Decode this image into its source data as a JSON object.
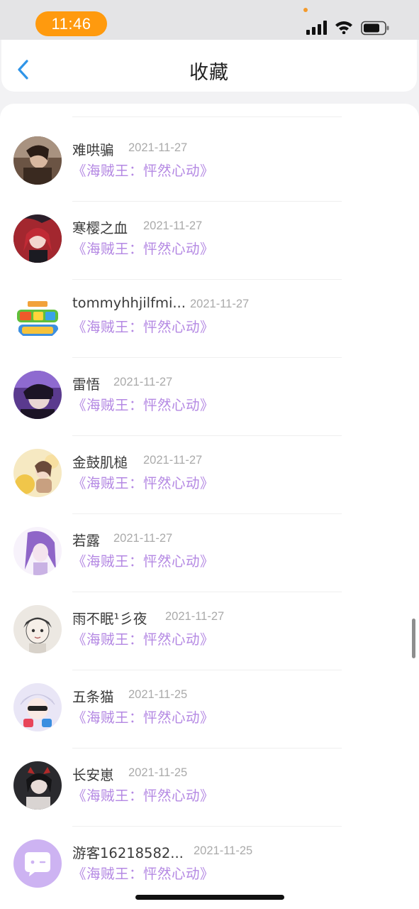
{
  "status_bar": {
    "time": "11:46",
    "icons": [
      "cellular-signal-icon",
      "wifi-icon",
      "battery-icon"
    ],
    "time_pill_color": "#ff9a0e"
  },
  "header": {
    "title": "收藏",
    "back_icon": "chevron-left-icon",
    "back_color": "#2f95e8"
  },
  "favorites": [
    {
      "username": "难哄骗",
      "date": "2021-11-27",
      "work": "《海贼王：怦然心动》"
    },
    {
      "username": "寒樱之血",
      "date": "2021-11-27",
      "work": "《海贼王：怦然心动》"
    },
    {
      "username": "tommyhhjilfmi...",
      "date": "2021-11-27",
      "work": "《海贼王：怦然心动》"
    },
    {
      "username": "雷悟",
      "date": "2021-11-27",
      "work": "《海贼王：怦然心动》"
    },
    {
      "username": "金鼓肌槌",
      "date": "2021-11-27",
      "work": "《海贼王：怦然心动》"
    },
    {
      "username": "若露",
      "date": "2021-11-27",
      "work": "《海贼王：怦然心动》"
    },
    {
      "username": "雨不眠¹彡夜",
      "date": "2021-11-27",
      "work": "《海贼王：怦然心动》"
    },
    {
      "username": "五条猫",
      "date": "2021-11-25",
      "work": "《海贼王：怦然心动》"
    },
    {
      "username": "长安崽",
      "date": "2021-11-25",
      "work": "《海贼王：怦然心动》"
    },
    {
      "username": "游客16218582...",
      "date": "2021-11-25",
      "work": "《海贼王：怦然心动》"
    }
  ],
  "colors": {
    "work_title": "#b488e3",
    "date": "#aaaaaa",
    "guest_avatar": "#cdb3f2"
  }
}
